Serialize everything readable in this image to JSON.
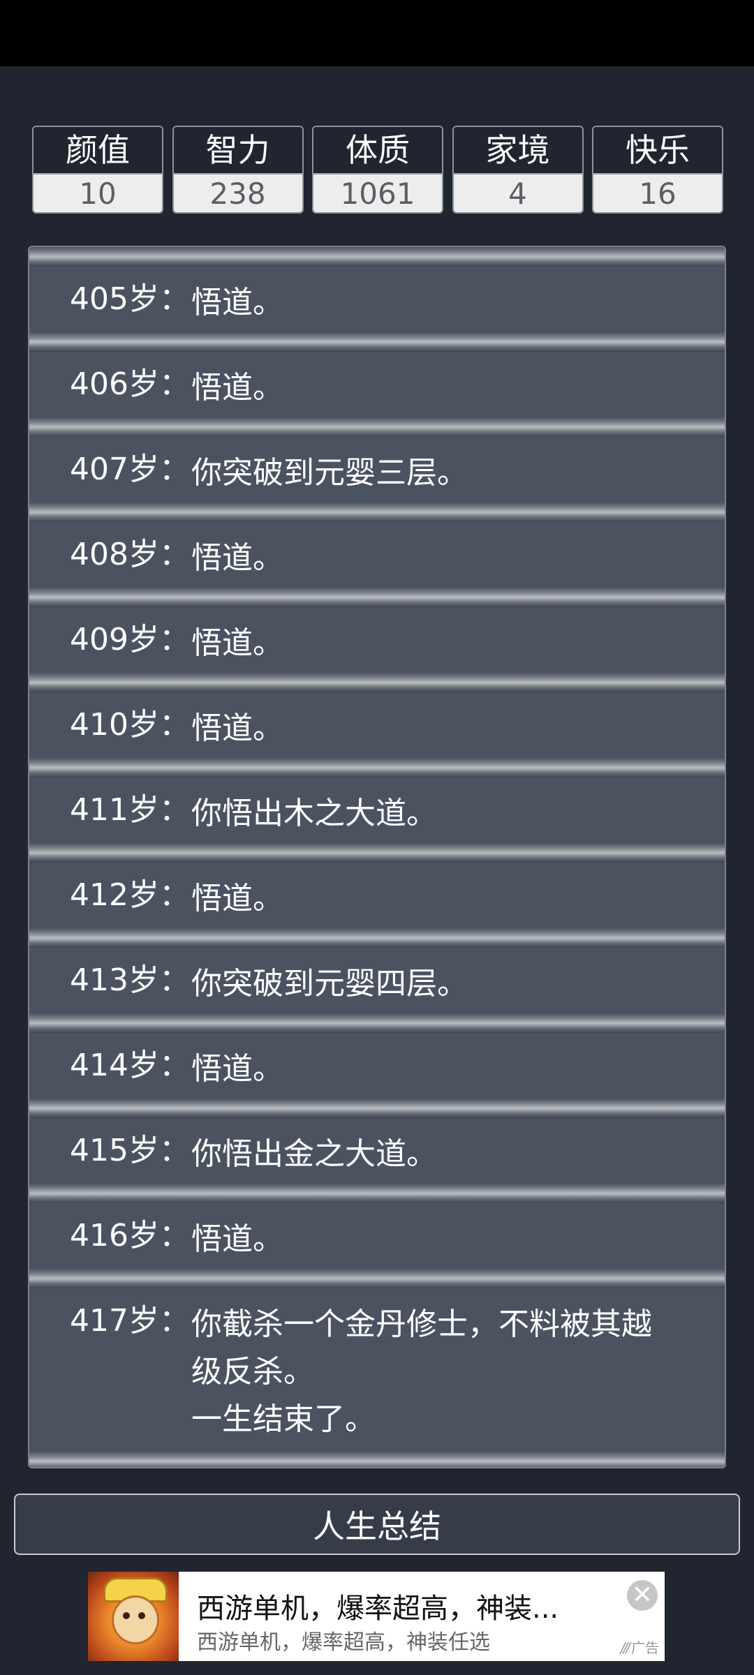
{
  "stats": [
    {
      "label": "颜值",
      "value": "10"
    },
    {
      "label": "智力",
      "value": "238"
    },
    {
      "label": "体质",
      "value": "1061"
    },
    {
      "label": "家境",
      "value": "4"
    },
    {
      "label": "快乐",
      "value": "16"
    }
  ],
  "log": [
    {
      "age": "405岁：",
      "lines": [
        "悟道。"
      ]
    },
    {
      "age": "406岁：",
      "lines": [
        "悟道。"
      ]
    },
    {
      "age": "407岁：",
      "lines": [
        "你突破到元婴三层。"
      ]
    },
    {
      "age": "408岁：",
      "lines": [
        "悟道。"
      ]
    },
    {
      "age": "409岁：",
      "lines": [
        "悟道。"
      ]
    },
    {
      "age": "410岁：",
      "lines": [
        "悟道。"
      ]
    },
    {
      "age": "411岁：",
      "lines": [
        "你悟出木之大道。"
      ]
    },
    {
      "age": "412岁：",
      "lines": [
        "悟道。"
      ]
    },
    {
      "age": "413岁：",
      "lines": [
        "你突破到元婴四层。"
      ]
    },
    {
      "age": "414岁：",
      "lines": [
        "悟道。"
      ]
    },
    {
      "age": "415岁：",
      "lines": [
        "你悟出金之大道。"
      ]
    },
    {
      "age": "416岁：",
      "lines": [
        "悟道。"
      ]
    },
    {
      "age": "417岁：",
      "lines": [
        "你截杀一个金丹修士，不料被其越",
        "级反杀。",
        "一生结束了。"
      ]
    }
  ],
  "summary_button": {
    "label": "人生总结"
  },
  "ad": {
    "title": "西游单机，爆率超高，神装...",
    "subtitle": "西游单机，爆率超高，神装任选",
    "close_symbol": "✕",
    "tag": "广告",
    "tag_mark": "///"
  }
}
